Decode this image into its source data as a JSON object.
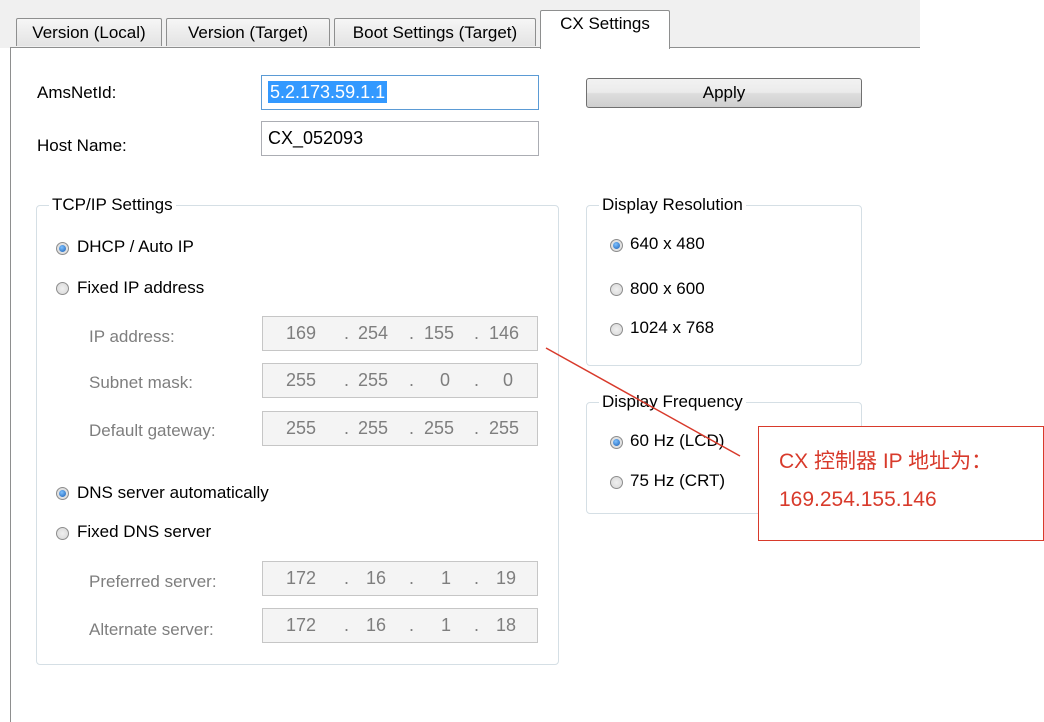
{
  "tabs": [
    {
      "label": "Version (Local)",
      "active": false
    },
    {
      "label": "Version (Target)",
      "active": false
    },
    {
      "label": "Boot Settings (Target)",
      "active": false
    },
    {
      "label": "CX Settings",
      "active": true
    }
  ],
  "fields": {
    "amsnetid_label": "AmsNetId:",
    "amsnetid_value": "5.2.173.59.1.1",
    "hostname_label": "Host Name:",
    "hostname_value": "CX_052093",
    "apply_label": "Apply"
  },
  "tcpip": {
    "title": "TCP/IP Settings",
    "dhcp_label": "DHCP / Auto IP",
    "dhcp_checked": true,
    "fixed_ip_label": "Fixed IP address",
    "fixed_ip_checked": false,
    "ip_label": "IP address:",
    "ip": [
      "169",
      "254",
      "155",
      "146"
    ],
    "subnet_label": "Subnet mask:",
    "subnet": [
      "255",
      "255",
      "0",
      "0"
    ],
    "gateway_label": "Default gateway:",
    "gateway": [
      "255",
      "255",
      "255",
      "255"
    ],
    "dns_auto_label": "DNS server automatically",
    "dns_auto_checked": true,
    "fixed_dns_label": "Fixed DNS server",
    "fixed_dns_checked": false,
    "preferred_label": "Preferred server:",
    "preferred": [
      "172",
      "16",
      "1",
      "19"
    ],
    "alternate_label": "Alternate server:",
    "alternate": [
      "172",
      "16",
      "1",
      "18"
    ]
  },
  "resolution": {
    "title": "Display Resolution",
    "options": [
      {
        "label": "640 x 480",
        "checked": true
      },
      {
        "label": "800 x 600",
        "checked": false
      },
      {
        "label": "1024 x 768",
        "checked": false
      }
    ]
  },
  "frequency": {
    "title": "Display Frequency",
    "options": [
      {
        "label": "60 Hz (LCD)",
        "checked": true
      },
      {
        "label": "75 Hz (CRT)",
        "checked": false
      }
    ]
  },
  "annotation": {
    "line1": "CX 控制器 IP 地址为：",
    "line2": "169.254.155.146",
    "color": "#d83a2b"
  },
  "icons": {
    "radio": "radio-button-icon"
  }
}
